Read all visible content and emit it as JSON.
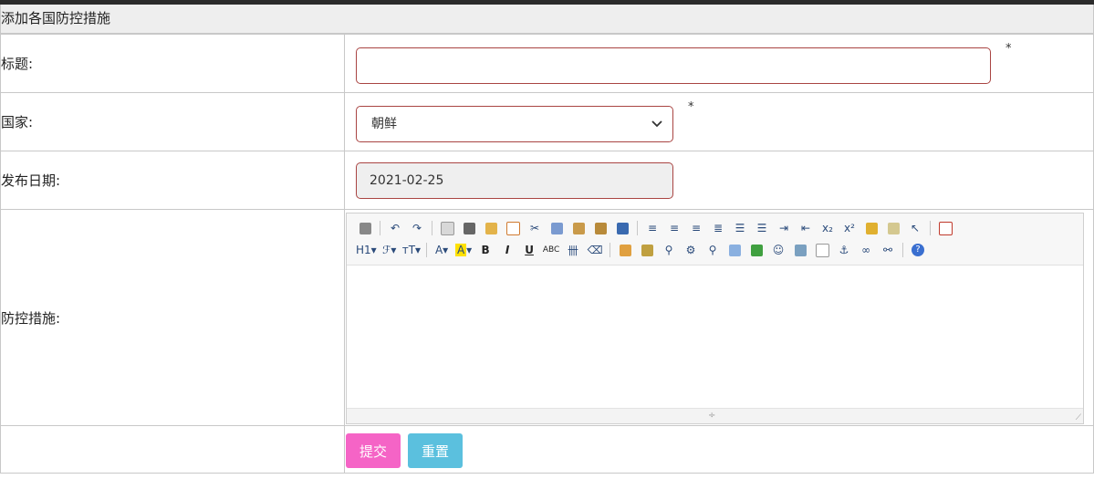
{
  "panel": {
    "title": "添加各国防控措施"
  },
  "form": {
    "title_field": {
      "label": "标题:",
      "value": "",
      "required_mark": "*"
    },
    "country_field": {
      "label": "国家:",
      "selected": "朝鲜",
      "required_mark": "*"
    },
    "date_field": {
      "label": "发布日期:",
      "value": "2021-02-25"
    },
    "measures_field": {
      "label": "防控措施:"
    }
  },
  "editor": {
    "toolbar_row1": [
      "source-icon",
      "undo-icon",
      "redo-icon",
      "preview-icon",
      "print-icon",
      "template-icon",
      "code-icon",
      "cut-icon",
      "copy-icon",
      "paste-icon",
      "paste-plain-icon",
      "paste-word-icon",
      "align-left-icon",
      "align-center-icon",
      "align-right-icon",
      "justify-icon",
      "ordered-list-icon",
      "unordered-list-icon",
      "indent-icon",
      "outdent-icon",
      "subscript-icon",
      "superscript-icon",
      "clear-format-icon",
      "select-all-icon",
      "pointer-icon",
      "fullscreen-icon"
    ],
    "toolbar_row2_text": {
      "heading": "H1",
      "font": "ℱ",
      "size": "ᴛT",
      "forecolor": "A",
      "hilite": "A",
      "bold": "B",
      "italic": "I",
      "underline": "U",
      "strike": "ABC",
      "lineheight": "卌"
    }
  },
  "buttons": {
    "submit": "提交",
    "reset": "重置"
  },
  "colors": {
    "border_error": "#a94442",
    "submit_bg": "#f564c6",
    "reset_bg": "#5bc0de",
    "header_bg": "#eeeeee"
  }
}
